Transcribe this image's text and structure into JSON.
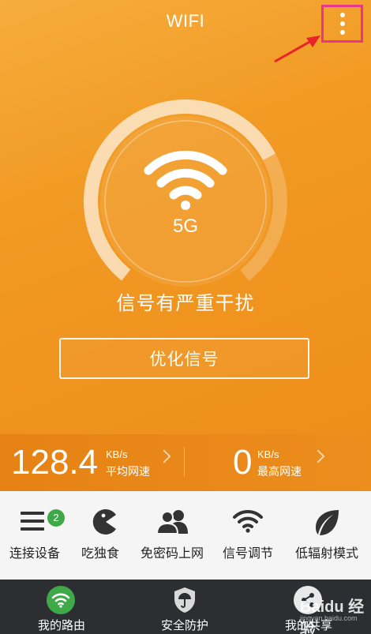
{
  "header": {
    "title": "WIFI",
    "menu_icon": "more-vertical-icon"
  },
  "signal": {
    "band": "5G",
    "status": "信号有严重干扰",
    "optimize_label": "优化信号",
    "gauge_level": 0.72
  },
  "speeds": [
    {
      "value": "128.4",
      "unit": "KB/s",
      "label": "平均网速"
    },
    {
      "value": "0",
      "unit": "KB/s",
      "label": "最高网速"
    }
  ],
  "tools": [
    {
      "label": "连接设备",
      "icon": "menu-list-icon",
      "badge": "2"
    },
    {
      "label": "吃独食",
      "icon": "pacman-icon"
    },
    {
      "label": "免密码上网",
      "icon": "users-icon"
    },
    {
      "label": "信号调节",
      "icon": "wifi-icon"
    },
    {
      "label": "低辐射模式",
      "icon": "leaf-icon"
    }
  ],
  "nav": [
    {
      "label": "我的路由",
      "icon": "wifi-icon"
    },
    {
      "label": "安全防护",
      "icon": "shield-umbrella-icon"
    },
    {
      "label": "我的共享",
      "icon": "share-icon"
    }
  ],
  "watermark": {
    "text": "Baidu 经验",
    "sub": "jingyan.baidu.com"
  },
  "colors": {
    "accent": "#f19a24",
    "badge": "#3fa94a",
    "nav_bg": "#2d2e31",
    "annotation": "#e8368f"
  }
}
